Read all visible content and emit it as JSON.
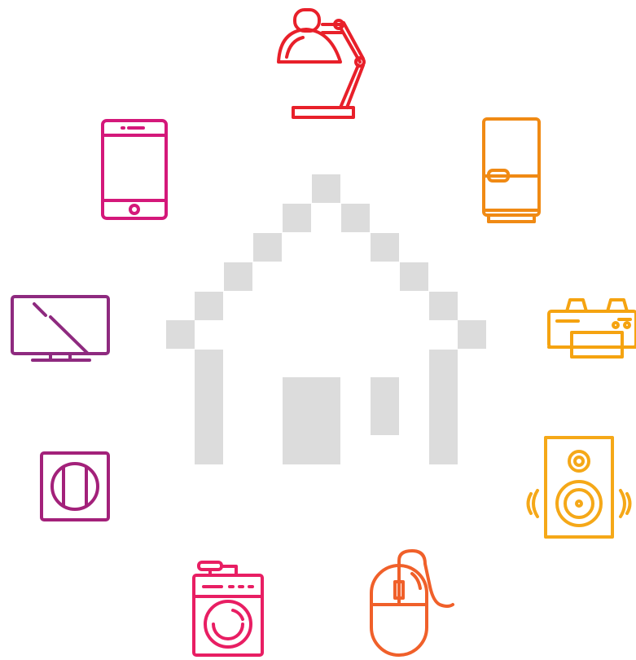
{
  "palette": {
    "house": "#dcdcdc",
    "lamp": "#e8202a",
    "fridge": "#f08a14",
    "printer": "#f5a310",
    "speaker": "#f5a818",
    "mouse": "#f0602a",
    "washer": "#e81e63",
    "outlet": "#a3217a",
    "tv": "#8e2a7f",
    "tablet": "#d4187a"
  },
  "icons": [
    {
      "name": "lamp-icon",
      "color_key": "lamp"
    },
    {
      "name": "fridge-icon",
      "color_key": "fridge"
    },
    {
      "name": "printer-icon",
      "color_key": "printer"
    },
    {
      "name": "speaker-icon",
      "color_key": "speaker"
    },
    {
      "name": "mouse-icon",
      "color_key": "mouse"
    },
    {
      "name": "washing-machine-icon",
      "color_key": "washer"
    },
    {
      "name": "wall-outlet-icon",
      "color_key": "outlet"
    },
    {
      "name": "monitor-icon",
      "color_key": "tv"
    },
    {
      "name": "tablet-icon",
      "color_key": "tablet"
    },
    {
      "name": "pixel-house-icon",
      "color_key": "house"
    }
  ]
}
